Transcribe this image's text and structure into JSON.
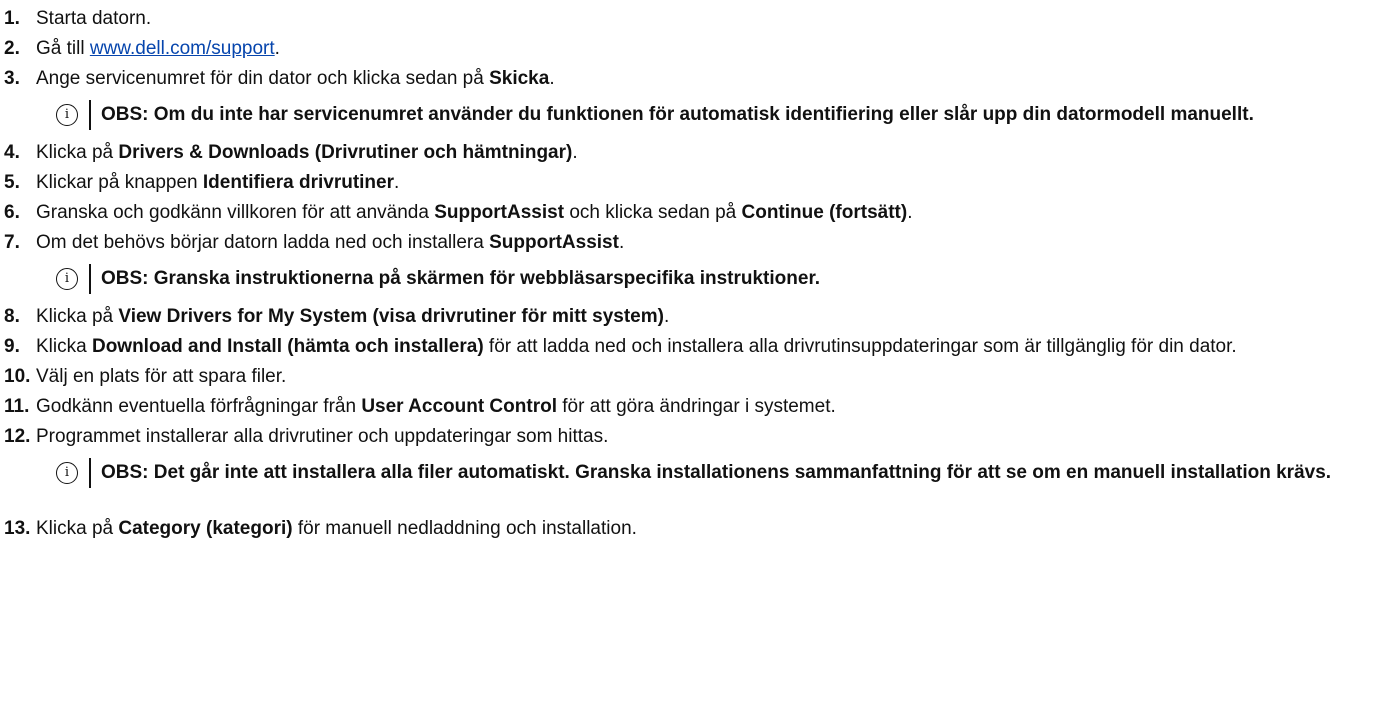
{
  "steps": [
    {
      "num": "1.",
      "parts": [
        {
          "t": "Starta datorn."
        }
      ]
    },
    {
      "num": "2.",
      "parts": [
        {
          "t": "Gå till "
        },
        {
          "t": "www.dell.com/support",
          "link": true
        },
        {
          "t": "."
        }
      ]
    },
    {
      "num": "3.",
      "parts": [
        {
          "t": "Ange servicenumret för din dator och klicka sedan på "
        },
        {
          "t": "Skicka",
          "b": true
        },
        {
          "t": "."
        }
      ]
    },
    {
      "num": "4.",
      "parts": [
        {
          "t": "Klicka på "
        },
        {
          "t": "Drivers & Downloads (Drivrutiner och hämtningar)",
          "b": true
        },
        {
          "t": "."
        }
      ]
    },
    {
      "num": "5.",
      "parts": [
        {
          "t": "Klickar på knappen "
        },
        {
          "t": "Identifiera drivrutiner",
          "b": true
        },
        {
          "t": "."
        }
      ]
    },
    {
      "num": "6.",
      "parts": [
        {
          "t": "Granska och godkänn villkoren för att använda "
        },
        {
          "t": "SupportAssist",
          "b": true
        },
        {
          "t": " och klicka sedan på "
        },
        {
          "t": "Continue (fortsätt)",
          "b": true
        },
        {
          "t": "."
        }
      ]
    },
    {
      "num": "7.",
      "parts": [
        {
          "t": "Om det behövs börjar datorn ladda ned och installera "
        },
        {
          "t": "SupportAssist",
          "b": true
        },
        {
          "t": "."
        }
      ]
    },
    {
      "num": "8.",
      "parts": [
        {
          "t": "Klicka på "
        },
        {
          "t": "View Drivers for My System (visa drivrutiner för mitt system)",
          "b": true
        },
        {
          "t": "."
        }
      ]
    },
    {
      "num": "9.",
      "parts": [
        {
          "t": "Klicka "
        },
        {
          "t": "Download and Install (hämta och installera)",
          "b": true
        },
        {
          "t": " för att ladda ned och installera alla drivrutinsuppdateringar som är tillgänglig för din dator."
        }
      ]
    },
    {
      "num": "10.",
      "parts": [
        {
          "t": "Välj en plats för att spara filer."
        }
      ]
    },
    {
      "num": "11.",
      "parts": [
        {
          "t": "Godkänn eventuella förfrågningar från "
        },
        {
          "t": "User Account Control",
          "b": true
        },
        {
          "t": " för att göra ändringar i systemet."
        }
      ]
    },
    {
      "num": "12.",
      "parts": [
        {
          "t": "Programmet installerar alla drivrutiner och uppdateringar som hittas."
        }
      ]
    },
    {
      "num": "13.",
      "parts": [
        {
          "t": "Klicka på "
        },
        {
          "t": "Category (kategori)",
          "b": true
        },
        {
          "t": " för manuell nedladdning och installation."
        }
      ]
    }
  ],
  "notes": {
    "note1": "OBS: Om du inte har servicenumret använder du funktionen för automatisk identifiering eller slår upp din datormodell manuellt.",
    "note2": "OBS: Granska instruktionerna på skärmen för webbläsarspecifika instruktioner.",
    "note3": "OBS: Det går inte att installera alla filer automatiskt. Granska installationens sammanfattning för att se om en manuell installation krävs."
  },
  "icons": {
    "info": "info-icon"
  }
}
